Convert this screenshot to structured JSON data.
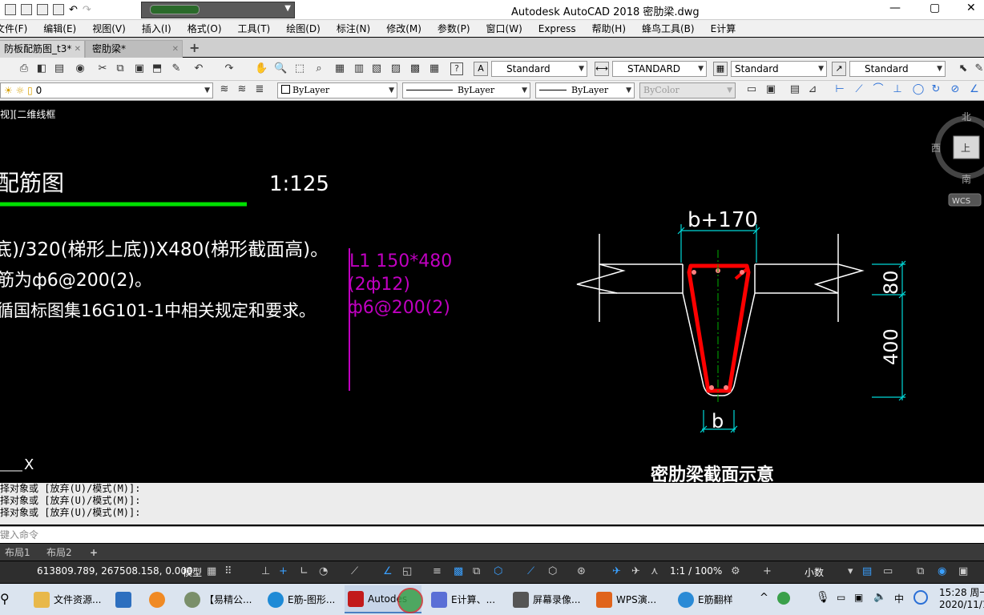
{
  "window": {
    "title": "Autodesk AutoCAD 2018    密肋梁.dwg",
    "minimize": "—",
    "maximize": "▢",
    "close": "✕"
  },
  "menu": [
    "文件(F)",
    "编辑(E)",
    "视图(V)",
    "插入(I)",
    "格式(O)",
    "工具(T)",
    "绘图(D)",
    "标注(N)",
    "修改(M)",
    "参数(P)",
    "窗口(W)",
    "Express",
    "帮助(H)",
    "蜂鸟工具(B)",
    "E计算"
  ],
  "tabs": [
    {
      "label": "防板配筋图_t3*",
      "close": "✕"
    },
    {
      "label": "密肋梁*",
      "close": "✕"
    }
  ],
  "toolbar1": {
    "text_style": "Standard",
    "dim_style": "STANDARD",
    "table_style": "Standard",
    "mleader_style": "Standard"
  },
  "toolbar2": {
    "layer": "0",
    "color": "ByLayer",
    "linetype": "ByLayer",
    "lineweight": "ByLayer",
    "plotstyle": "ByColor"
  },
  "viewport": {
    "label": "视][二维线框",
    "compass": {
      "north": "北",
      "west": "西",
      "south": "南",
      "top": "上",
      "wcs": "WCS"
    }
  },
  "drawing": {
    "heading": "配筋图",
    "scale": "1:125",
    "note1": "底)/320(梯形上底))X480(梯形截面高)。",
    "note2": "筋为ф6@200(2)。",
    "note3": "循国标图集16G101-1中相关规定和要求。",
    "beam_label1": "L1 150*480",
    "beam_label2": "(2ф12)",
    "beam_label3": "ф6@200(2)",
    "dim_top": "b+170",
    "dim_bottom": "b",
    "dim_80": "80",
    "dim_400": "400",
    "caption": "密肋梁截面示意",
    "ucs_x": "X",
    "colors": {
      "green": "#00e000",
      "magenta": "#c000c0",
      "cyan": "#00d8d8",
      "red": "#ff0000"
    }
  },
  "command": {
    "history": [
      "择对象或 [放弃(U)/模式(M)]:",
      "择对象或 [放弃(U)/模式(M)]:",
      "择对象或 [放弃(U)/模式(M)]:"
    ],
    "input_placeholder": "键入命令"
  },
  "layout_tabs": [
    "布局1",
    "布局2",
    "+"
  ],
  "status": {
    "coords": "613809.789, 267508.158, 0.000",
    "model": "模型",
    "annoscale": "1:1 / 100%",
    "units": "小数"
  },
  "taskbar": {
    "items": [
      {
        "label": "文件资源..."
      },
      {
        "label": ""
      },
      {
        "label": ""
      },
      {
        "label": "【易精公..."
      },
      {
        "label": "E筋-图形..."
      },
      {
        "label": "Autodes"
      },
      {
        "label": "E计算、..."
      },
      {
        "label": "屏幕录像..."
      },
      {
        "label": "WPS演..."
      },
      {
        "label": "E筋翻样"
      }
    ],
    "time": "15:28 周一",
    "date": "2020/11/1"
  }
}
